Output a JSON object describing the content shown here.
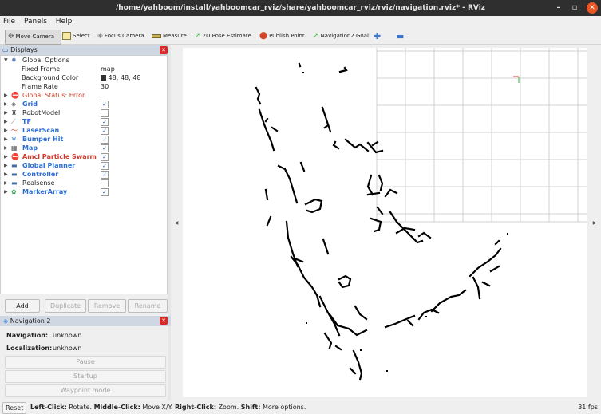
{
  "window": {
    "title": "/home/yahboom/install/yahboomcar_rviz/share/yahboomcar_rviz/rviz/navigation.rviz* - RViz",
    "min_label": "–",
    "max_label": "▫",
    "close_label": "✕"
  },
  "menubar": {
    "items": [
      {
        "label": "File"
      },
      {
        "label": "Panels"
      },
      {
        "label": "Help"
      }
    ]
  },
  "toolbar": {
    "move_camera": "Move Camera",
    "select": "Select",
    "focus_camera": "Focus Camera",
    "measure": "Measure",
    "pose_estimate": "2D Pose Estimate",
    "publish_point": "Publish Point",
    "nav2_goal": "Navigation2 Goal",
    "plus": "✚",
    "minus": "▬"
  },
  "displays": {
    "title": "Displays",
    "global_options": {
      "label": "Global Options",
      "fixed_frame": {
        "label": "Fixed Frame",
        "value": "map"
      },
      "background_color": {
        "label": "Background Color",
        "value": "48; 48; 48",
        "swatch": "#303030"
      },
      "frame_rate": {
        "label": "Frame Rate",
        "value": "30"
      }
    },
    "items": [
      {
        "label": "Global Status: Error",
        "checked": null,
        "style": "red",
        "icon": "error-icon"
      },
      {
        "label": "Grid",
        "checked": true,
        "style": "blue",
        "icon": "grid-icon"
      },
      {
        "label": "RobotModel",
        "checked": false,
        "style": "normal",
        "icon": "robot-icon"
      },
      {
        "label": "TF",
        "checked": true,
        "style": "blue",
        "icon": "tf-icon"
      },
      {
        "label": "LaserScan",
        "checked": true,
        "style": "blue",
        "icon": "laserscan-icon"
      },
      {
        "label": "Bumper Hit",
        "checked": true,
        "style": "blue",
        "icon": "bumper-icon"
      },
      {
        "label": "Map",
        "checked": true,
        "style": "blue",
        "icon": "map-icon"
      },
      {
        "label": "Amcl Particle Swarm",
        "checked": true,
        "style": "redb",
        "icon": "error-icon"
      },
      {
        "label": "Global Planner",
        "checked": true,
        "style": "blue",
        "icon": "folder-icon"
      },
      {
        "label": "Controller",
        "checked": true,
        "style": "blue",
        "icon": "folder-icon"
      },
      {
        "label": "Realsense",
        "checked": false,
        "style": "normal",
        "icon": "folder-icon"
      },
      {
        "label": "MarkerArray",
        "checked": true,
        "style": "blue",
        "icon": "marker-icon"
      }
    ],
    "buttons": {
      "add": "Add",
      "duplicate": "Duplicate",
      "remove": "Remove",
      "rename": "Rename"
    }
  },
  "navigation": {
    "title": "Navigation 2",
    "navigation_label": "Navigation:",
    "navigation_value": "unknown",
    "localization_label": "Localization:",
    "localization_value": "unknown",
    "pause": "Pause",
    "startup": "Startup",
    "waypoint": "Waypoint mode"
  },
  "status": {
    "reset": "Reset",
    "left_click": "Left-Click:",
    "left_text": "Rotate.",
    "middle_click": "Middle-Click:",
    "middle_text": "Move X/Y.",
    "right_click": "Right-Click:",
    "right_text": "Zoom.",
    "shift": "Shift:",
    "shift_text": "More options.",
    "fps": "31 fps"
  },
  "colors": {
    "view_background": "#ffffff",
    "map_obstacle": "#000000",
    "grid_line": "#cfcfcf",
    "accent_blue": "#2a6ed6",
    "error_red": "#d23a2a"
  }
}
